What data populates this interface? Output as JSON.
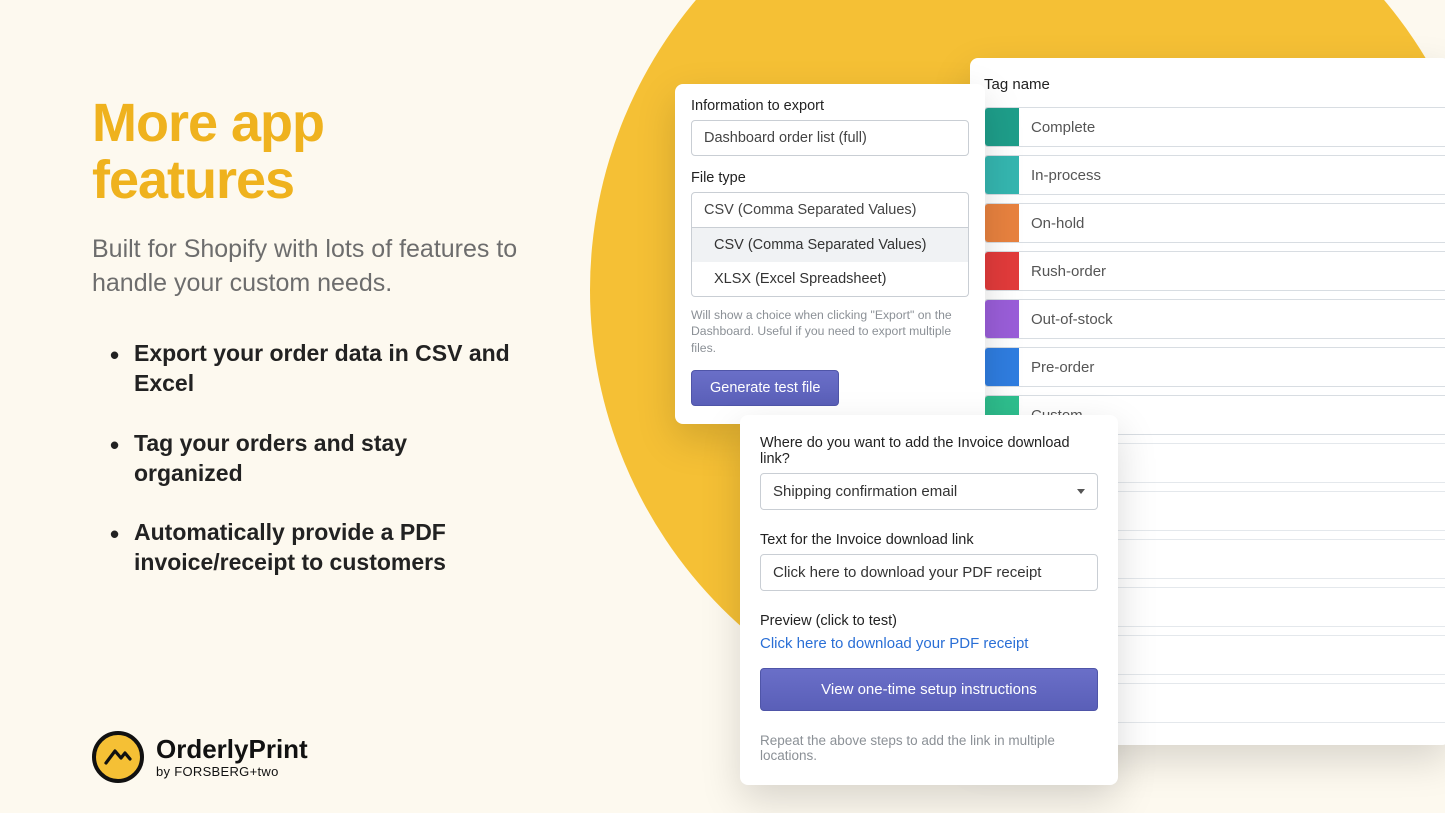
{
  "hero": {
    "headline": "More app features",
    "sub": "Built for Shopify with lots of features to handle your custom needs.",
    "bullets": [
      "Export your order data in CSV and Excel",
      "Tag your orders and stay organized",
      "Automatically provide a PDF invoice/receipt to customers"
    ]
  },
  "logo": {
    "name": "OrderlyPrint",
    "byline": "by FORSBERG+two"
  },
  "export_panel": {
    "info_label": "Information to export",
    "info_value": "Dashboard order list (full)",
    "filetype_label": "File type",
    "filetype_value": "CSV (Comma Separated Values)",
    "options": [
      "CSV (Comma Separated Values)",
      "XLSX (Excel Spreadsheet)"
    ],
    "help": "Will show a choice when clicking \"Export\" on the Dashboard. Useful if you need to export multiple files.",
    "button": "Generate test file"
  },
  "tag_panel": {
    "title": "Tag name",
    "tags": [
      {
        "label": "Complete",
        "color": "#1e9e8a"
      },
      {
        "label": "In-process",
        "color": "#35b6b0"
      },
      {
        "label": "On-hold",
        "color": "#e8823f"
      },
      {
        "label": "Rush-order",
        "color": "#e23b3b"
      },
      {
        "label": "Out-of-stock",
        "color": "#9a5ed9"
      },
      {
        "label": "Pre-order",
        "color": "#2f7de0"
      },
      {
        "label": "Custom",
        "color": "#2fc08f"
      }
    ]
  },
  "invoice_panel": {
    "q1": "Where do you want to add the Invoice download link?",
    "select_value": "Shipping confirmation email",
    "q2": "Text for the Invoice download link",
    "input_value": "Click here to download your PDF receipt",
    "preview_label": "Preview (click to test)",
    "preview_link": "Click here to download your PDF receipt",
    "button": "View one-time setup instructions",
    "repeat": "Repeat the above steps to add the link in multiple locations."
  }
}
